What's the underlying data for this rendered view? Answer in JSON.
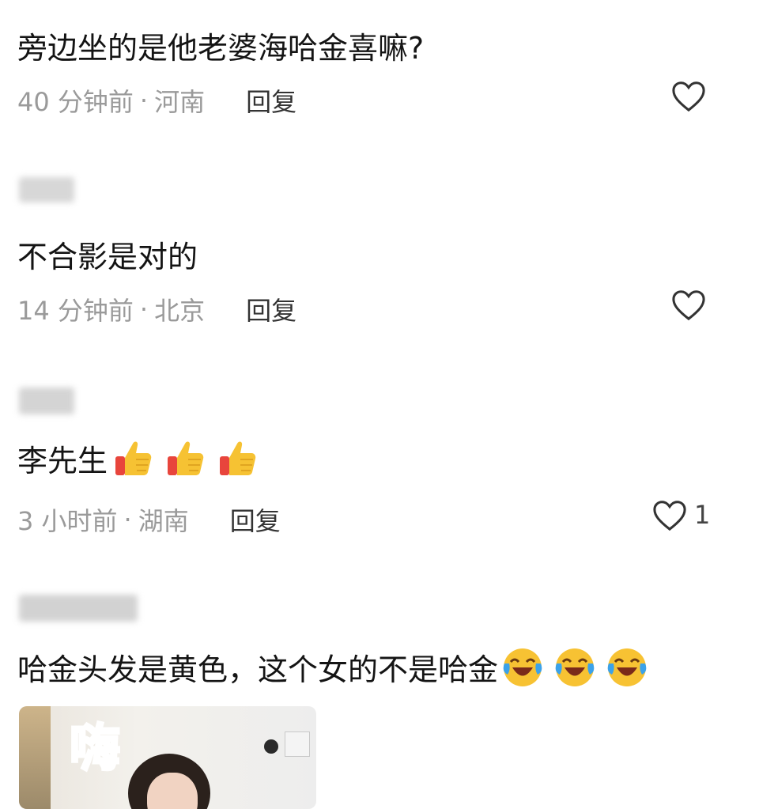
{
  "comments": [
    {
      "username": "",
      "text": "旁边坐的是他老婆海哈金喜嘛?",
      "time": "40 分钟前",
      "location": "河南",
      "reply_label": "回复",
      "like_count": ""
    },
    {
      "username": "",
      "text": "不合影是对的",
      "time": "14 分钟前",
      "location": "北京",
      "reply_label": "回复",
      "like_count": ""
    },
    {
      "username": "",
      "text": "李先生",
      "emojis": [
        "thumbs-up-icon",
        "thumbs-up-icon",
        "thumbs-up-icon"
      ],
      "time": "3 小时前",
      "location": "湖南",
      "reply_label": "回复",
      "like_count": "1"
    },
    {
      "username": "",
      "text": "哈金头发是黄色，这个女的不是哈金",
      "emojis": [
        "laughing-crying-icon",
        "laughing-crying-icon",
        "laughing-crying-icon"
      ]
    }
  ],
  "separator": "·",
  "photo_caption": "嗨",
  "colors": {
    "text": "#141414",
    "meta": "#9a9a9a",
    "reply": "#333333",
    "thumb": "#f6c233",
    "cuff": "#e8453c"
  }
}
